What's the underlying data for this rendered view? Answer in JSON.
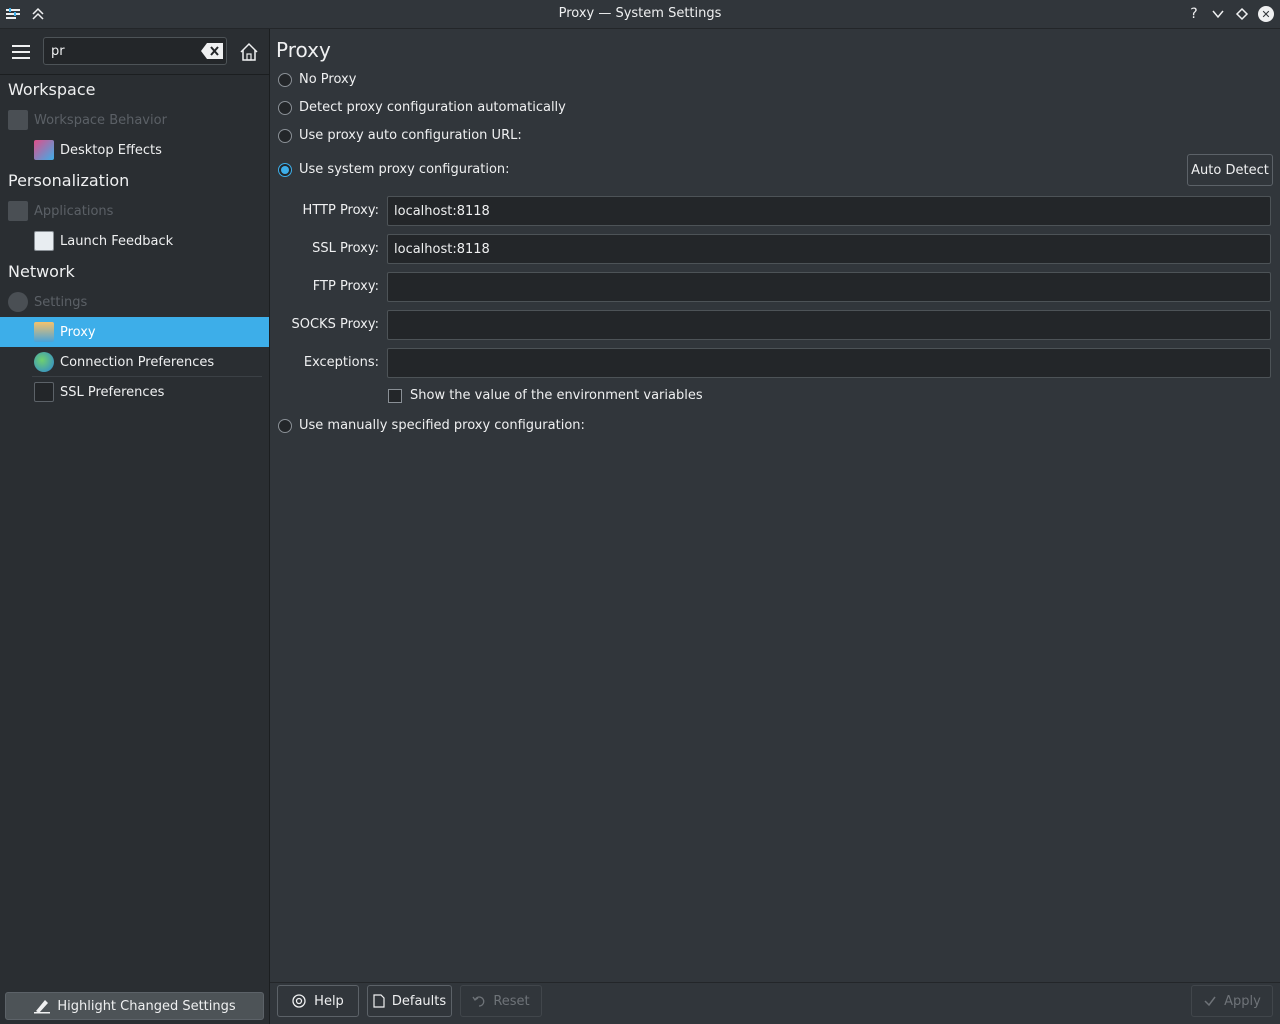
{
  "window": {
    "title": "Proxy — System Settings"
  },
  "sidebar": {
    "search_value": "pr",
    "sections": [
      {
        "heading": "Workspace",
        "category": "Workspace Behavior",
        "items": [
          "Desktop Effects"
        ]
      },
      {
        "heading": "Personalization",
        "category": "Applications",
        "items": [
          "Launch Feedback"
        ]
      },
      {
        "heading": "Network",
        "category": "Settings",
        "items": [
          "Proxy",
          "Connection Preferences",
          "SSL Preferences"
        ]
      }
    ],
    "selected_item": "Proxy",
    "highlight_label": "Highlight Changed Settings"
  },
  "main": {
    "title": "Proxy",
    "options": {
      "no_proxy": "No Proxy",
      "detect_auto": "Detect proxy configuration automatically",
      "auto_url": "Use proxy auto configuration URL:",
      "system": "Use system proxy configuration:",
      "manual": "Use manually specified proxy configuration:"
    },
    "selected_option": "system",
    "auto_detect_label": "Auto Detect",
    "fields": {
      "http": {
        "label": "HTTP Proxy:",
        "value": "localhost:8118"
      },
      "ssl": {
        "label": "SSL Proxy:",
        "value": "localhost:8118"
      },
      "ftp": {
        "label": "FTP Proxy:",
        "value": ""
      },
      "socks": {
        "label": "SOCKS Proxy:",
        "value": ""
      },
      "exceptions": {
        "label": "Exceptions:",
        "value": ""
      }
    },
    "show_env_label": "Show the value of the environment variables",
    "show_env_checked": false
  },
  "footer": {
    "help": "Help",
    "defaults": "Defaults",
    "reset": "Reset",
    "apply": "Apply"
  },
  "colors": {
    "accent": "#3daee9",
    "background": "#31363b",
    "sidebar": "#2a2e32"
  }
}
